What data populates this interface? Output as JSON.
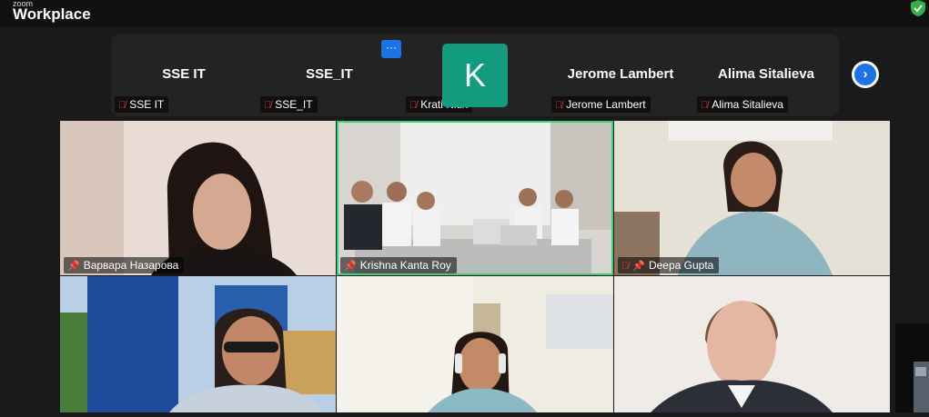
{
  "app": {
    "brand_small": "zoom",
    "brand_big": "Workplace"
  },
  "strip": {
    "tiles": [
      {
        "name": "SSE IT",
        "label": "SSE IT"
      },
      {
        "name": "SSE_IT",
        "label": "SSE_IT"
      },
      {
        "avatar_letter": "K",
        "label": "Krati Nitin"
      },
      {
        "name": "Jerome Lambert",
        "label": "Jerome Lambert"
      },
      {
        "name": "Alima Sitalieva",
        "label": "Alima Sitalieva"
      }
    ],
    "more_icon": "···",
    "next_icon": "›"
  },
  "gallery": {
    "tiles": [
      {
        "label": "Варвара Назарова"
      },
      {
        "label": "Krishna Kanta Roy"
      },
      {
        "label": "Deepa Gupta"
      }
    ]
  },
  "colors": {
    "active_speaker": "#2fd67e",
    "avatar_bg": "#149b7f",
    "accent": "#1a73e8"
  }
}
